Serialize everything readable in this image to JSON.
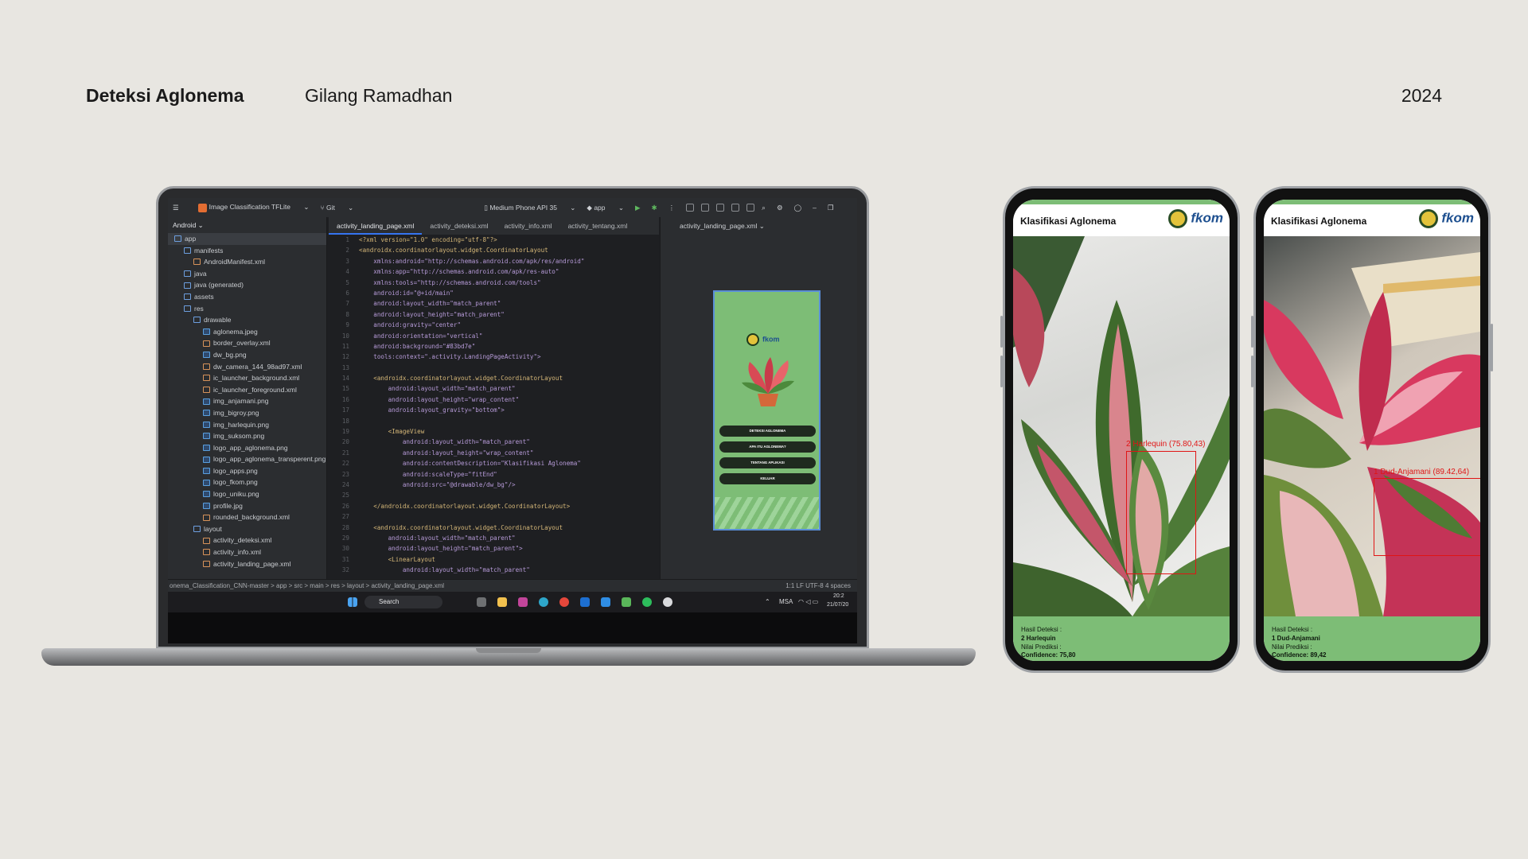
{
  "header": {
    "title": "Deteksi Aglonema",
    "author": "Gilang Ramadhan",
    "year": "2024"
  },
  "ide": {
    "project_name": "Image Classification TFLite",
    "vcs": "Git",
    "device": "Medium Phone API 35",
    "run_config": "app",
    "panel_label": "Android",
    "tabs": [
      "activity_landing_page.xml",
      "activity_deteksi.xml",
      "activity_info.xml",
      "activity_tentang.xml"
    ],
    "preview_file": "activity_landing_page.xml",
    "tree": [
      {
        "label": "app",
        "level": 0,
        "type": "folder"
      },
      {
        "label": "manifests",
        "level": 1,
        "type": "folder"
      },
      {
        "label": "AndroidManifest.xml",
        "level": 2,
        "type": "file"
      },
      {
        "label": "java",
        "level": 1,
        "type": "folder"
      },
      {
        "label": "java (generated)",
        "level": 1,
        "type": "folder"
      },
      {
        "label": "assets",
        "level": 1,
        "type": "folder"
      },
      {
        "label": "res",
        "level": 1,
        "type": "folder"
      },
      {
        "label": "drawable",
        "level": 2,
        "type": "folder"
      },
      {
        "label": "aglonema.jpeg",
        "level": 3,
        "type": "img"
      },
      {
        "label": "border_overlay.xml",
        "level": 3,
        "type": "file"
      },
      {
        "label": "dw_bg.png",
        "level": 3,
        "type": "img"
      },
      {
        "label": "dw_camera_144_98ad97.xml",
        "level": 3,
        "type": "file"
      },
      {
        "label": "ic_launcher_background.xml",
        "level": 3,
        "type": "file"
      },
      {
        "label": "ic_launcher_foreground.xml",
        "level": 3,
        "type": "file"
      },
      {
        "label": "img_anjamani.png",
        "level": 3,
        "type": "img"
      },
      {
        "label": "img_bigroy.png",
        "level": 3,
        "type": "img"
      },
      {
        "label": "img_harlequin.png",
        "level": 3,
        "type": "img"
      },
      {
        "label": "img_suksom.png",
        "level": 3,
        "type": "img"
      },
      {
        "label": "logo_app_aglonema.png",
        "level": 3,
        "type": "img"
      },
      {
        "label": "logo_app_aglonema_transperent.png",
        "level": 3,
        "type": "img"
      },
      {
        "label": "logo_apps.png",
        "level": 3,
        "type": "img"
      },
      {
        "label": "logo_fkom.png",
        "level": 3,
        "type": "img"
      },
      {
        "label": "logo_uniku.png",
        "level": 3,
        "type": "img"
      },
      {
        "label": "profile.jpg",
        "level": 3,
        "type": "img"
      },
      {
        "label": "rounded_background.xml",
        "level": 3,
        "type": "file"
      },
      {
        "label": "layout",
        "level": 2,
        "type": "folder"
      },
      {
        "label": "activity_deteksi.xml",
        "level": 3,
        "type": "file"
      },
      {
        "label": "activity_info.xml",
        "level": 3,
        "type": "file"
      },
      {
        "label": "activity_landing_page.xml",
        "level": 3,
        "type": "file"
      }
    ],
    "code_lines": [
      "<?xml version=\"1.0\" encoding=\"utf-8\"?>",
      "<androidx.coordinatorlayout.widget.CoordinatorLayout",
      "    xmlns:android=\"http://schemas.android.com/apk/res/android\"",
      "    xmlns:app=\"http://schemas.android.com/apk/res-auto\"",
      "    xmlns:tools=\"http://schemas.android.com/tools\"",
      "    android:id=\"@+id/main\"",
      "    android:layout_width=\"match_parent\"",
      "    android:layout_height=\"match_parent\"",
      "    android:gravity=\"center\"",
      "    android:orientation=\"vertical\"",
      "    android:background=\"#83bd7e\"",
      "    tools:context=\".activity.LandingPageActivity\">",
      "",
      "    <androidx.coordinatorlayout.widget.CoordinatorLayout",
      "        android:layout_width=\"match_parent\"",
      "        android:layout_height=\"wrap_content\"",
      "        android:layout_gravity=\"bottom\">",
      "",
      "        <ImageView",
      "            android:layout_width=\"match_parent\"",
      "            android:layout_height=\"wrap_content\"",
      "            android:contentDescription=\"Klasifikasi Aglonema\"",
      "            android:scaleType=\"fitEnd\"",
      "            android:src=\"@drawable/dw_bg\"/>",
      "",
      "    </androidx.coordinatorlayout.widget.CoordinatorLayout>",
      "",
      "    <androidx.coordinatorlayout.widget.CoordinatorLayout",
      "        android:layout_width=\"match_parent\"",
      "        android:layout_height=\"match_parent\">",
      "        <LinearLayout",
      "            android:layout_width=\"match_parent\""
    ],
    "preview_buttons": [
      "DETEKSI AGLONEMA",
      "APA ITU AGLONEMA?",
      "TENTANG APLIKASI",
      "KELUAR"
    ],
    "preview_logo": "fkom",
    "status_path": "onema_Classification_CNN-master  >  app  >  src  >  main  >  res  >  layout  >  activity_landing_page.xml",
    "status_right": "1:1   LF   UTF-8   4 spaces",
    "taskbar": {
      "search": "Search",
      "lang": "MSA",
      "time": "20:2",
      "date": "21/07/20"
    }
  },
  "phones": [
    {
      "title": "Klasifikasi Aglonema",
      "logo": "fkom",
      "detection_label": "2 Harlequin (75.80,43)",
      "result_heading": "Hasil Deteksi :",
      "result_value": "2 Harlequin",
      "pred_heading": "Nilai Prediksi :",
      "confidence": "Confidence: 75,80",
      "leaf_colors": [
        "#3f6a2c",
        "#c4566a",
        "#e2a9a6"
      ]
    },
    {
      "title": "Klasifikasi Aglonema",
      "logo": "fkom",
      "detection_label": "1 Dud-Anjamani (89.42,64)",
      "result_heading": "Hasil Deteksi :",
      "result_value": "1 Dud-Anjamani",
      "pred_heading": "Nilai Prediksi :",
      "confidence": "Confidence: 89,42",
      "leaf_colors": [
        "#4f7b34",
        "#d8395f",
        "#f0a2b2"
      ]
    }
  ]
}
